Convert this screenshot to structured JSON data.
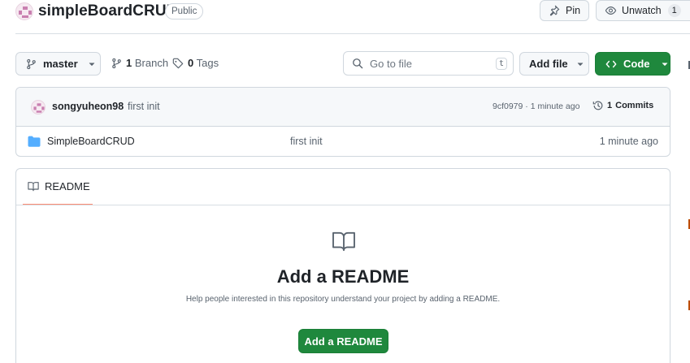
{
  "header": {
    "repo_name": "simpleBoardCRUD",
    "visibility": "Public",
    "pin_label": "Pin",
    "unwatch_label": "Unwatch",
    "watch_count": "1"
  },
  "toolbar": {
    "branch": "master",
    "branch_count": "1",
    "branch_label": "Branch",
    "tag_count": "0",
    "tag_label": "Tags",
    "search_placeholder": "Go to file",
    "search_shortcut": "t",
    "add_file_label": "Add file",
    "code_label": "Code"
  },
  "latest_commit": {
    "author": "songyuheon98",
    "message": "first init",
    "hash_time": "9cf0979 · 1 minute ago",
    "commits_count": "1",
    "commits_label": "Commits"
  },
  "files": [
    {
      "name": "SimpleBoardCRUD",
      "commit_message": "first init",
      "time": "1 minute ago",
      "icon": "folder-icon"
    }
  ],
  "readme": {
    "tab_label": "README",
    "heading": "Add a README",
    "description": "Help people interested in this repository understand your project by adding a README.",
    "button_label": "Add a README"
  },
  "colors": {
    "primary_green": "#1f883d",
    "folder_blue": "#54aeff",
    "tab_underline": "#fd8c73"
  }
}
